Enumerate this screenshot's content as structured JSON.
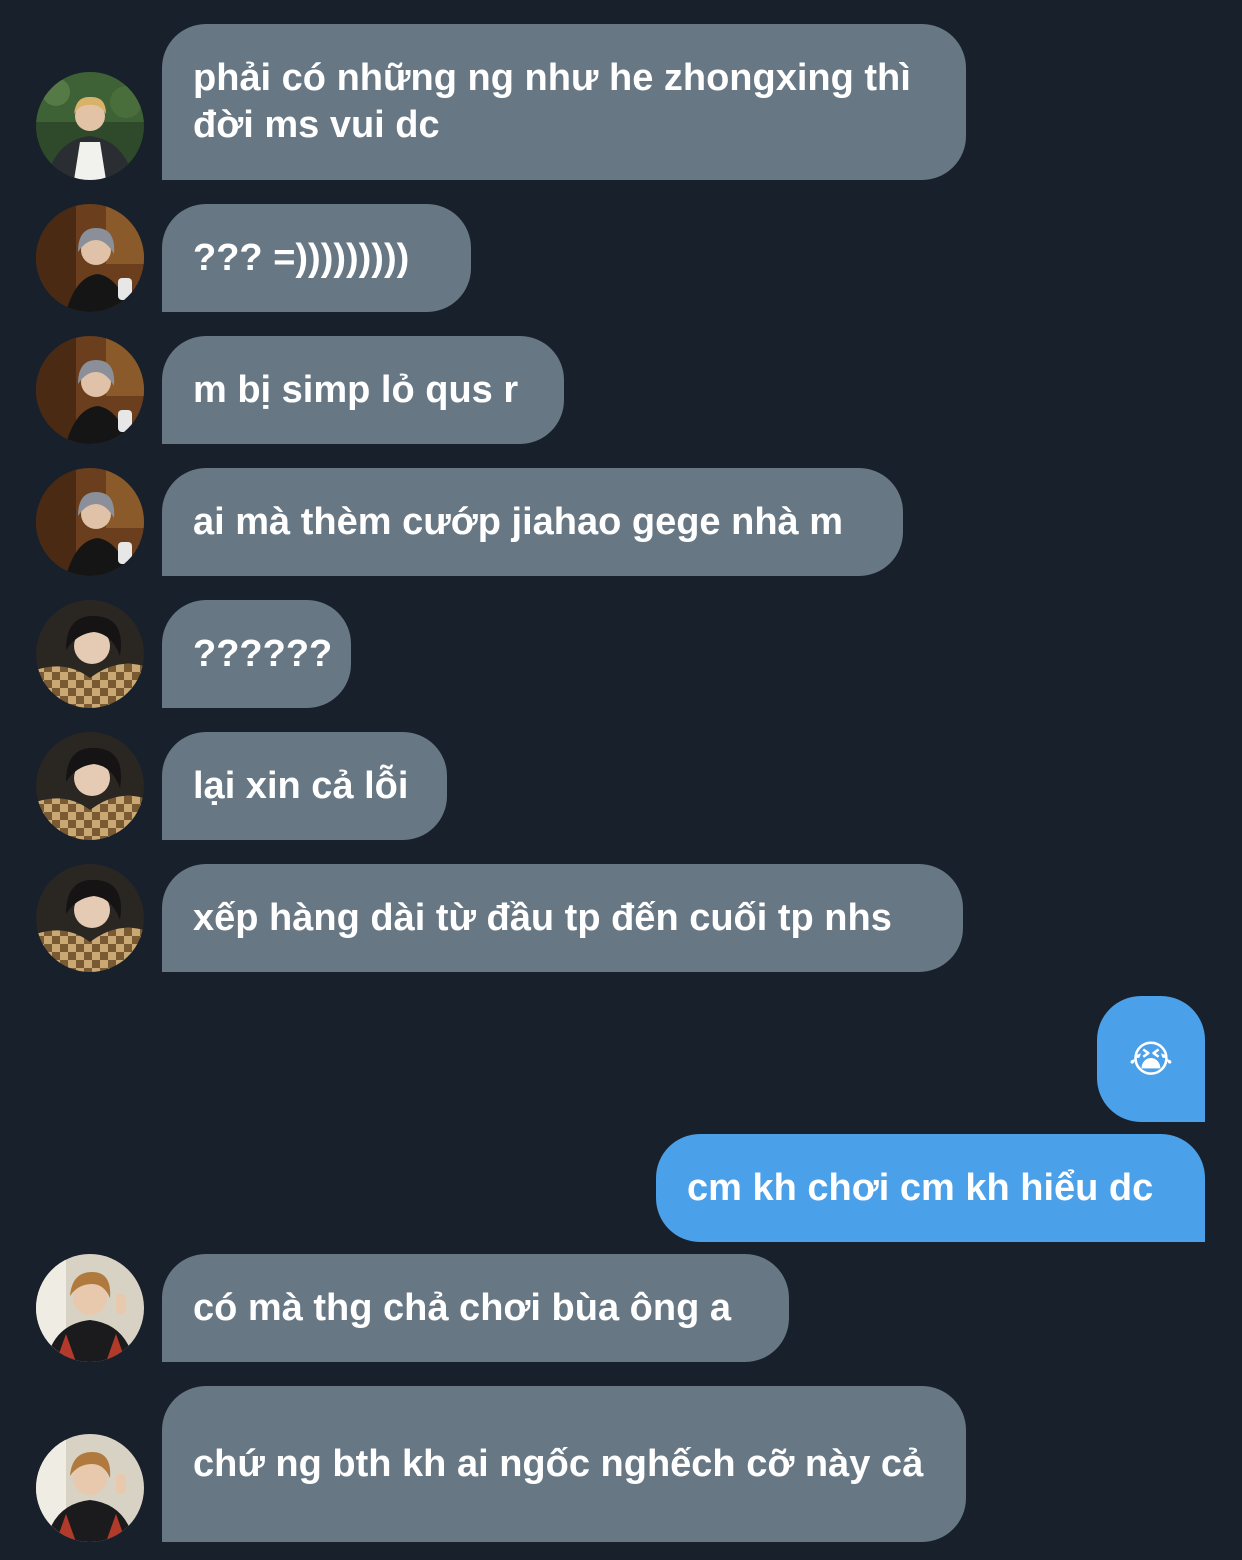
{
  "colors": {
    "background": "#18202b",
    "incoming_bubble": "#687784",
    "outgoing_bubble": "#4ba0ea",
    "text": "#ffffff"
  },
  "messages": [
    {
      "direction": "incoming",
      "avatar": "user-a-photo",
      "text": "phải có những ng như he zhongxing thì đời ms vui dc"
    },
    {
      "direction": "incoming",
      "avatar": "user-b-photo",
      "text": "??? =)))))))))"
    },
    {
      "direction": "incoming",
      "avatar": "user-b-photo",
      "text": "m bị simp lỏ qus r"
    },
    {
      "direction": "incoming",
      "avatar": "user-b-photo",
      "text": "ai mà thèm cướp jiahao gege nhà m"
    },
    {
      "direction": "incoming",
      "avatar": "user-c-photo",
      "text": "??????"
    },
    {
      "direction": "incoming",
      "avatar": "user-c-photo",
      "text": "lại xin cả lỗi"
    },
    {
      "direction": "incoming",
      "avatar": "user-c-photo",
      "text": "xếp hàng dài từ đầu tp đến cuối tp nhs"
    },
    {
      "direction": "outgoing",
      "text": "😭",
      "icon": "loudly-crying-face-emoji"
    },
    {
      "direction": "outgoing",
      "text": "cm kh chơi cm kh hiểu dc"
    },
    {
      "direction": "incoming",
      "avatar": "user-d-photo",
      "text": "có mà thg chả chơi bùa ông a"
    },
    {
      "direction": "incoming",
      "avatar": "user-d-photo",
      "text": "chứ ng bth kh ai ngốc nghếch cỡ này cả"
    }
  ]
}
